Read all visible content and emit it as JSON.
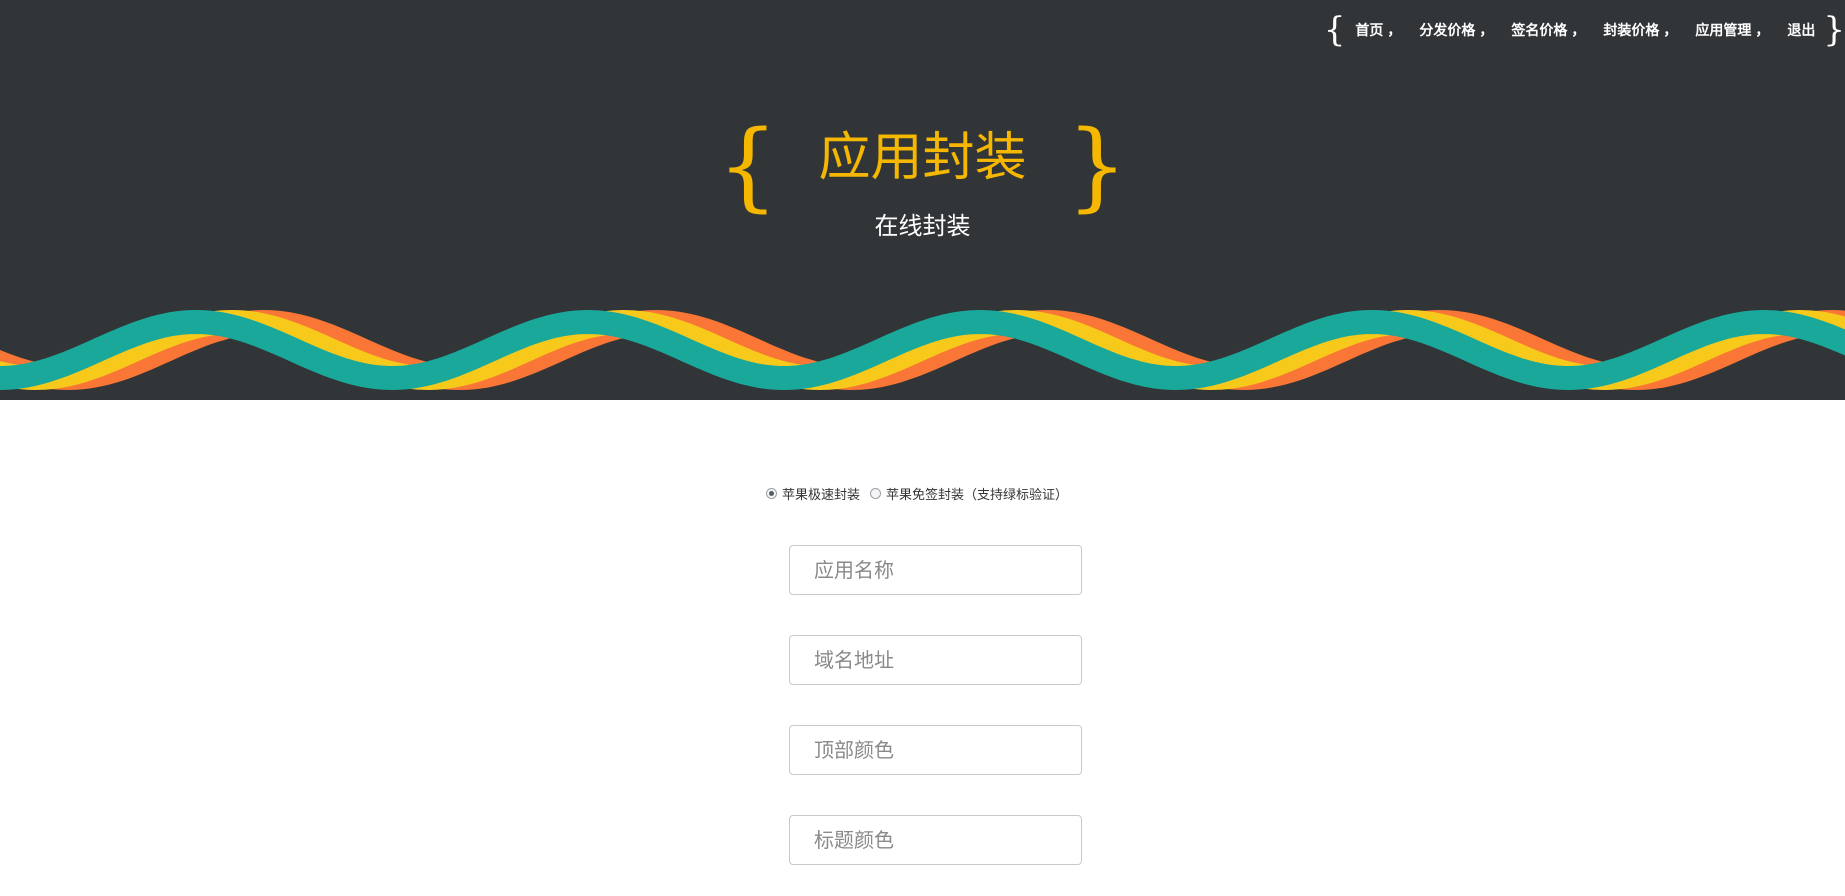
{
  "nav": {
    "open_brace": "{",
    "close_brace": "}",
    "separator": "，",
    "items": [
      {
        "label": "首页"
      },
      {
        "label": "分发价格"
      },
      {
        "label": "签名价格"
      },
      {
        "label": "封装价格"
      },
      {
        "label": "应用管理"
      },
      {
        "label": "退出"
      }
    ]
  },
  "hero": {
    "open_brace": "{",
    "close_brace": "}",
    "title": "应用封装",
    "subtitle": "在线封装"
  },
  "form": {
    "options": [
      {
        "label": "苹果极速封装",
        "checked": true
      },
      {
        "label": "苹果免签封装（支持绿标验证）",
        "checked": false
      }
    ],
    "fields": [
      {
        "placeholder": "应用名称",
        "value": ""
      },
      {
        "placeholder": "域名地址",
        "value": ""
      },
      {
        "placeholder": "顶部颜色",
        "value": ""
      },
      {
        "placeholder": "标题颜色",
        "value": ""
      }
    ]
  },
  "colors": {
    "header_bg": "#313538",
    "accent_gold": "#f5b700",
    "wave_teal": "#1aa89b",
    "wave_yellow": "#f7c91b",
    "wave_orange": "#f97637"
  }
}
